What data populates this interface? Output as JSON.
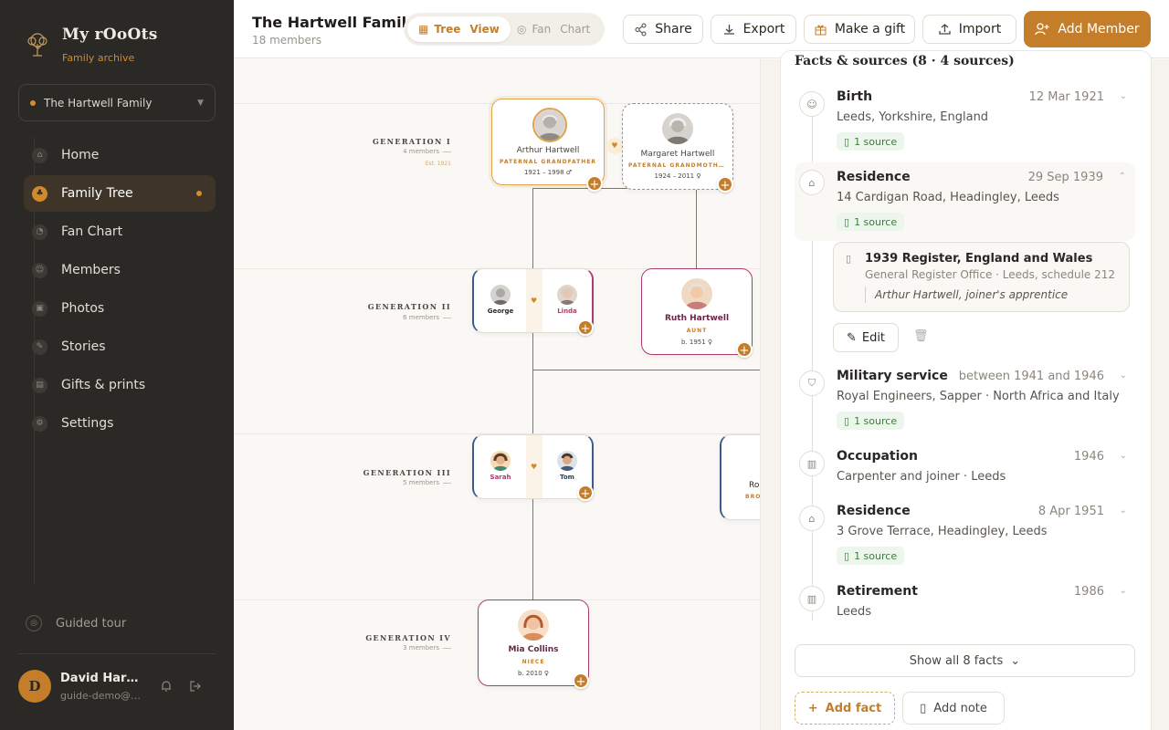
{
  "brand": {
    "name": "My rOoOts",
    "subtitle": "Family archive"
  },
  "family_select": {
    "value": "The Hartwell Family"
  },
  "nav": {
    "items": [
      {
        "label": "Home",
        "icon": "home-icon"
      },
      {
        "label": "Family Tree",
        "icon": "tree-icon",
        "active": true
      },
      {
        "label": "Fan Chart",
        "icon": "fan-chart-icon"
      },
      {
        "label": "Members",
        "icon": "members-icon"
      },
      {
        "label": "Photos",
        "icon": "photos-icon"
      },
      {
        "label": "Stories",
        "icon": "stories-icon"
      },
      {
        "label": "Gifts & prints",
        "icon": "gift-icon"
      },
      {
        "label": "Settings",
        "icon": "settings-icon"
      }
    ],
    "guided_tour": "Guided tour"
  },
  "user": {
    "initial": "D",
    "name": "David Hartwell",
    "email": "guide-demo@myrooots.app"
  },
  "header": {
    "title": "The Hartwell Family",
    "subtitle": "18 members",
    "view_toggle": {
      "tree": "Tree",
      "tree_view": "View",
      "fan": "Fan",
      "fan_chart": "Chart"
    },
    "buttons": {
      "share": "Share",
      "export": "Export",
      "gift": "Make a gift",
      "import": "Import",
      "add_member": "Add Member"
    }
  },
  "generations": [
    {
      "label": "GENERATION I",
      "count": "4 members",
      "extra": "Est. 1921"
    },
    {
      "label": "GENERATION II",
      "count": "6 members"
    },
    {
      "label": "GENERATION III",
      "count": "5 members"
    },
    {
      "label": "GENERATION IV",
      "count": "3 members"
    }
  ],
  "tree": {
    "arthur": {
      "name": "Arthur Hartwell",
      "role": "PATERNAL GRANDFATHER",
      "dates": "1921 – 1998 ♂"
    },
    "margaret": {
      "name": "Margaret Hartwell",
      "role": "PATERNAL GRANDMOTHER",
      "dates": "1924 – 2011 ♀"
    },
    "george": {
      "name": "George"
    },
    "linda": {
      "name": "Linda"
    },
    "ruth": {
      "name": "Ruth Hartwell",
      "role": "AUNT",
      "dates": "b. 1951 ♀"
    },
    "sarah": {
      "name": "Sarah"
    },
    "tom": {
      "name": "Tom"
    },
    "partial": {
      "name": "Ro",
      "role": "BRO"
    },
    "mia": {
      "name": "Mia Collins",
      "role": "NIECE",
      "dates": "b. 2010 ♀"
    }
  },
  "panel": {
    "heading": "Facts & sources (8 · 4 sources)",
    "facts": [
      {
        "title": "Birth",
        "date": "12 Mar 1921",
        "desc": "Leeds, Yorkshire, England",
        "source": "1 source",
        "icon": "birth-icon"
      },
      {
        "title": "Residence",
        "date": "29 Sep 1939",
        "desc": "14 Cardigan Road, Headingley, Leeds",
        "source": "1 source",
        "icon": "home-icon"
      },
      {
        "title": "Military service",
        "date": "between 1941 and 1946",
        "desc": "Royal Engineers, Sapper · North Africa and Italy",
        "source": "1 source",
        "icon": "shield-icon"
      },
      {
        "title": "Occupation",
        "date": "1946",
        "desc": "Carpenter and joiner · Leeds",
        "icon": "briefcase-icon"
      },
      {
        "title": "Residence",
        "date": "8 Apr 1951",
        "desc": "3 Grove Terrace, Headingley, Leeds",
        "source": "1 source",
        "icon": "home-icon"
      },
      {
        "title": "Retirement",
        "date": "1986",
        "desc": "Leeds",
        "icon": "briefcase-icon"
      }
    ],
    "source_card": {
      "title": "1939 Register, England and Wales",
      "sub": "General Register Office · Leeds, schedule 212",
      "quote": "Arthur Hartwell, joiner's apprentice"
    },
    "edit": "Edit",
    "show_all": "Show all 8 facts",
    "add_fact": "Add fact",
    "add_note": "Add note"
  }
}
